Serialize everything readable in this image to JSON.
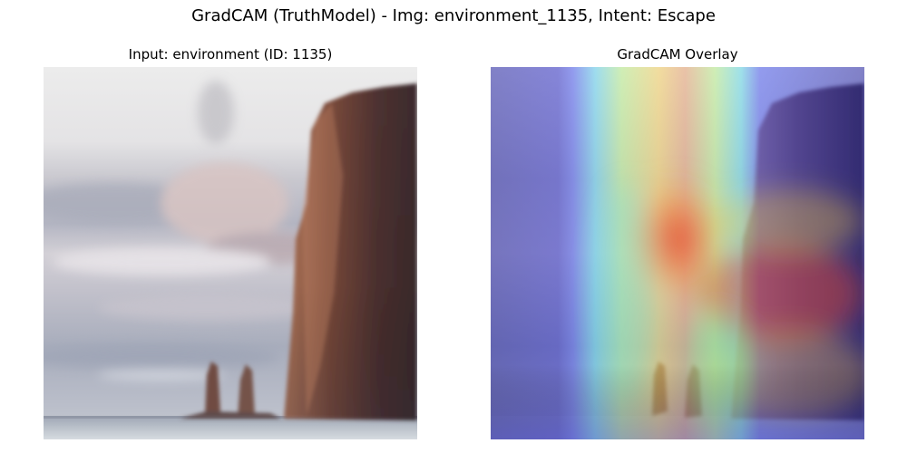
{
  "figure": {
    "title": "GradCAM (TruthModel) - Img: environment_1135, Intent: Escape"
  },
  "panels": [
    {
      "title": "Input: environment (ID: 1135)"
    },
    {
      "title": "GradCAM Overlay"
    }
  ]
}
